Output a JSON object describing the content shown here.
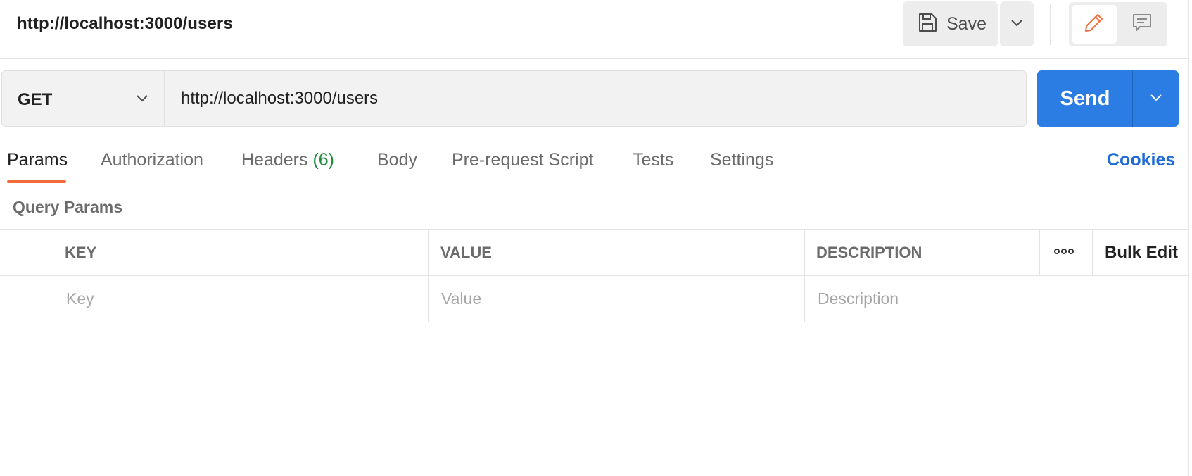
{
  "header": {
    "request_name": "http://localhost:3000/users",
    "save_label": "Save",
    "icons": {
      "save": "floppy-disk-icon",
      "save_dropdown": "chevron-down-icon",
      "edit": "pencil-icon",
      "comments": "comment-icon"
    }
  },
  "request": {
    "method": "GET",
    "url": "http://localhost:3000/users",
    "send_label": "Send"
  },
  "tabs": [
    {
      "label": "Params",
      "active": true
    },
    {
      "label": "Authorization"
    },
    {
      "label": "Headers",
      "count": "(6)"
    },
    {
      "label": "Body"
    },
    {
      "label": "Pre-request Script"
    },
    {
      "label": "Tests"
    },
    {
      "label": "Settings"
    }
  ],
  "cookies_label": "Cookies",
  "query_params": {
    "title": "Query Params",
    "columns": [
      "KEY",
      "VALUE",
      "DESCRIPTION"
    ],
    "bulk_edit_label": "Bulk Edit",
    "placeholders": {
      "key": "Key",
      "value": "Value",
      "description": "Description"
    }
  },
  "colors": {
    "accent_orange": "#f26b3a",
    "send_blue": "#2b7de3",
    "link_blue": "#1f6bd6",
    "count_green": "#1f8a3c"
  }
}
